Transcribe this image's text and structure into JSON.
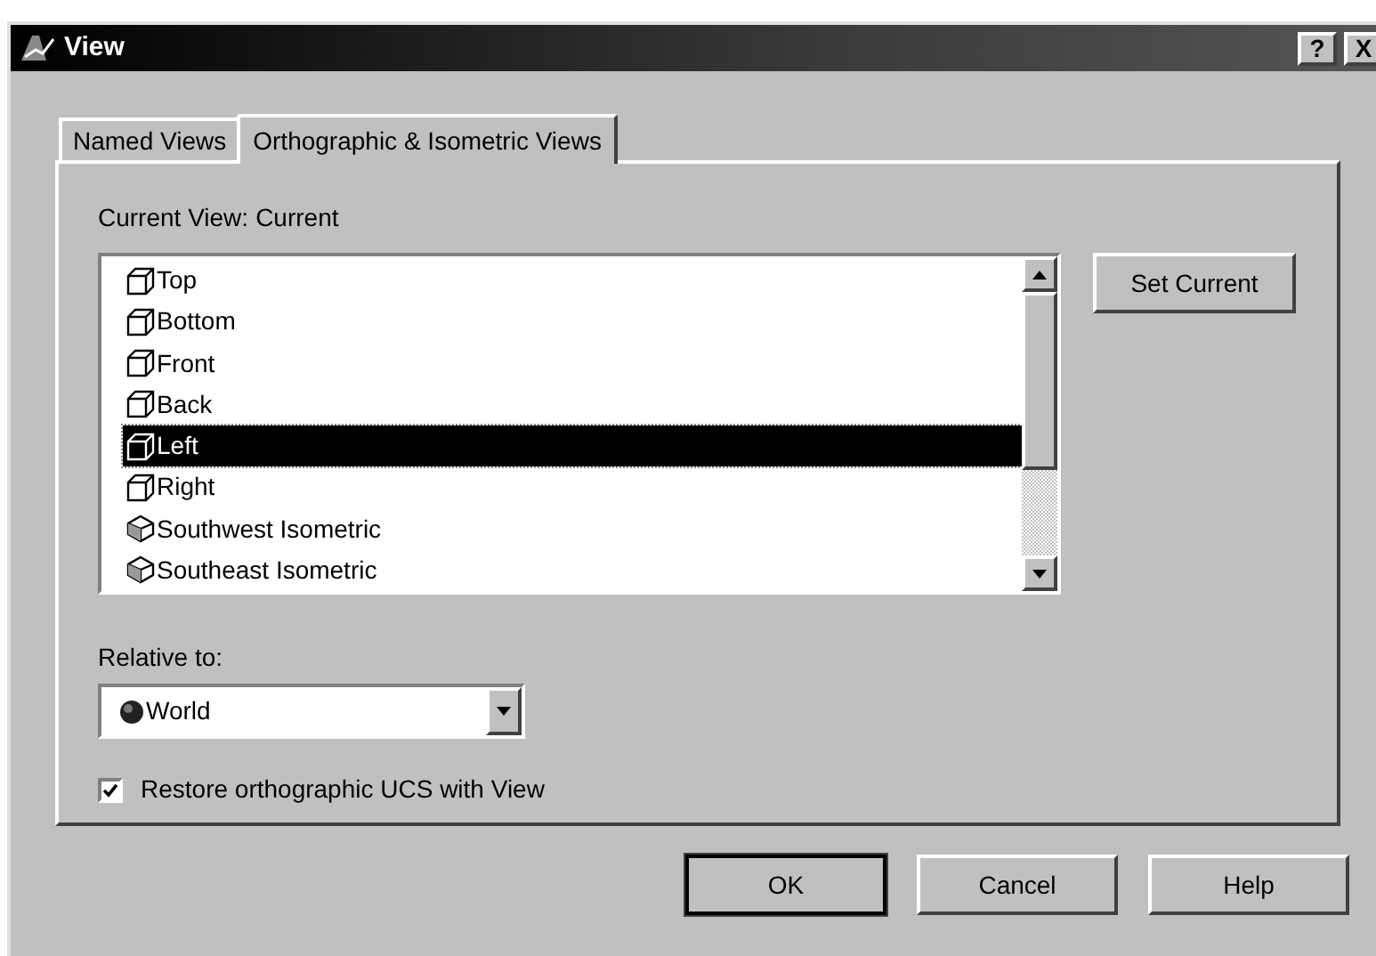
{
  "window": {
    "title": "View",
    "help_button": "?",
    "close_button": "X"
  },
  "tabs": [
    {
      "label": "Named Views",
      "selected": false
    },
    {
      "label": "Orthographic & Isometric Views",
      "selected": true
    }
  ],
  "current_view": {
    "label": "Current View:",
    "value": "Current"
  },
  "views": [
    {
      "label": "Top",
      "kind": "cube",
      "selected": false
    },
    {
      "label": "Bottom",
      "kind": "cube",
      "selected": false
    },
    {
      "label": "Front",
      "kind": "cube",
      "selected": false
    },
    {
      "label": "Back",
      "kind": "cube",
      "selected": false
    },
    {
      "label": "Left",
      "kind": "cube",
      "selected": true
    },
    {
      "label": "Right",
      "kind": "cube",
      "selected": false
    },
    {
      "label": "Southwest Isometric",
      "kind": "iso",
      "selected": false
    },
    {
      "label": "Southeast Isometric",
      "kind": "iso",
      "selected": false
    }
  ],
  "set_current_button": "Set Current",
  "relative_to": {
    "label": "Relative to:",
    "value": "World"
  },
  "restore_ucs": {
    "label": "Restore orthographic UCS with View",
    "checked": true
  },
  "buttons": [
    "OK",
    "Cancel",
    "Help"
  ]
}
